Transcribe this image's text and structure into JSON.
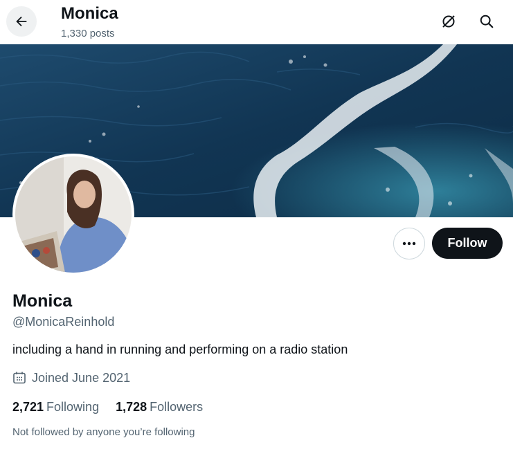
{
  "header": {
    "title": "Monica",
    "posts_count": "1,330 posts",
    "back_icon": "arrow-left-icon",
    "notifications_icon": "bell-slash-icon",
    "search_icon": "search-icon"
  },
  "profile": {
    "display_name": "Monica",
    "handle": "@MonicaReinhold",
    "bio": "including a hand in running and performing on a radio station",
    "joined": "Joined June 2021",
    "following_count": "2,721",
    "following_label": "Following",
    "followers_count": "1,728",
    "followers_label": "Followers",
    "mutual_note": "Not followed by anyone you’re following"
  },
  "actions": {
    "more_icon": "more-dots-icon",
    "follow_label": "Follow"
  },
  "colors": {
    "text_primary": "#0f1419",
    "text_secondary": "#536471",
    "follow_button_bg": "#0f1419",
    "banner_water": "#123a5c"
  }
}
